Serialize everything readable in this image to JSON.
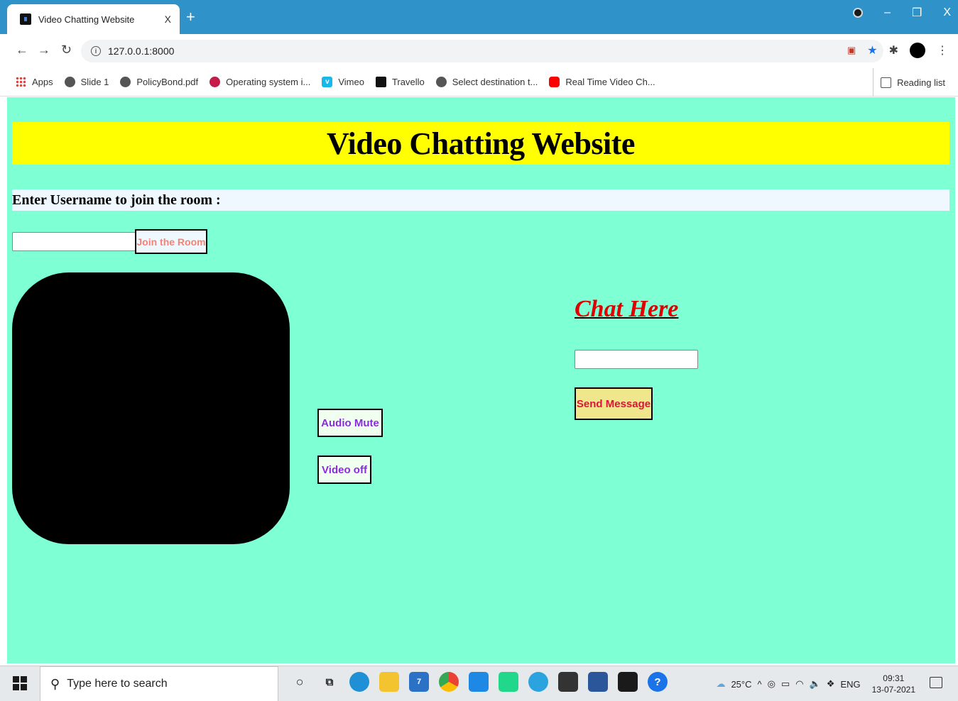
{
  "browser": {
    "tab_title": "Video Chatting Website",
    "tab_close": "X",
    "new_tab": "+",
    "url": "127.0.0.1:8000",
    "info_glyph": "i",
    "bookmarks": [
      {
        "label": "Apps",
        "icon": "apps-grid-icon"
      },
      {
        "label": "Slide 1",
        "icon": "globe-icon"
      },
      {
        "label": "PolicyBond.pdf",
        "icon": "globe-icon"
      },
      {
        "label": "Operating system i...",
        "icon": "raspberry-icon"
      },
      {
        "label": "Vimeo",
        "icon": "vimeo-icon"
      },
      {
        "label": "Travello",
        "icon": "travello-icon"
      },
      {
        "label": "Select destination t...",
        "icon": "globe-icon"
      },
      {
        "label": "Real Time Video Ch...",
        "icon": "youtube-icon"
      }
    ],
    "reading_list": "Reading list",
    "window_controls": {
      "minimize": "–",
      "restore": "❐",
      "close": "X"
    }
  },
  "page": {
    "title": "Video Chatting Website",
    "username_label": "Enter Username to join the room :",
    "join_button": "Join the Room",
    "audio_button": "Audio Mute",
    "video_button": "Video off",
    "chat_heading": "Chat Here",
    "send_button": "Send Message"
  },
  "colors": {
    "page_background": "#7fffd4",
    "banner": "#ffff00",
    "chat_heading": "#e00000",
    "send_button_bg": "#f0e68c"
  },
  "taskbar": {
    "search_placeholder": "Type here to search",
    "mail_badge": "7",
    "temperature": "25°C",
    "language": "ENG",
    "time": "09:31",
    "date": "13-07-2021"
  }
}
